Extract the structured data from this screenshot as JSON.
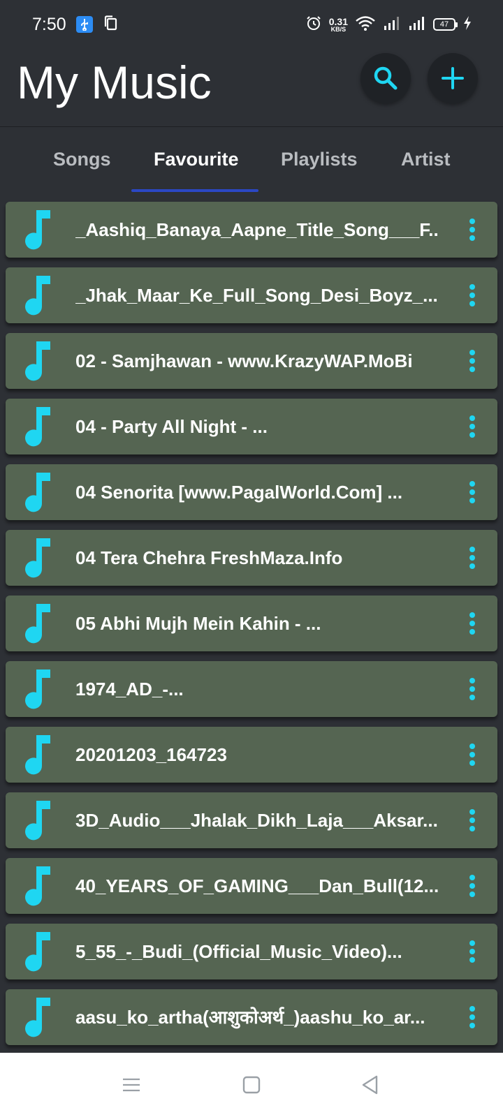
{
  "status_bar": {
    "time": "7:50",
    "net_speed_value": "0.31",
    "net_speed_unit": "KB/S",
    "battery": "47",
    "icons": [
      "usb-icon",
      "copy-icon",
      "alarm-icon",
      "wifi-icon",
      "signal-icon",
      "signal-icon",
      "battery-icon",
      "charging-icon"
    ]
  },
  "header": {
    "title": "My Music",
    "search_icon": "search-icon",
    "add_icon": "plus-icon"
  },
  "tabs": [
    {
      "label": "Songs",
      "active": false
    },
    {
      "label": "Favourite",
      "active": true
    },
    {
      "label": "Playlists",
      "active": false
    },
    {
      "label": "Artist",
      "active": false
    }
  ],
  "songs": [
    "_Aashiq_Banaya_Aapne_Title_Song___F...",
    "_Jhak_Maar_Ke_Full_Song_Desi_Boyz_...",
    "02 - Samjhawan - www.KrazyWAP.MoBi",
    "04 - Party All Night - ...",
    "04 Senorita [www.PagalWorld.Com] ...",
    "04 Tera Chehra FreshMaza.Info",
    "05 Abhi Mujh Mein Kahin  - ...",
    "1974_AD_-...",
    "20201203_164723",
    "3D_Audio___Jhalak_Dikh_Laja___Aksar...",
    "40_YEARS_OF_GAMING___Dan_Bull(12...",
    "5_55_-_Budi_(Official_Music_Video)...",
    "aasu_ko_artha(आशुकोअर्थ_)aashu_ko_ar..."
  ],
  "colors": {
    "background": "#2d3035",
    "card": "#556552",
    "accent": "#1fd6f2",
    "tab_indicator": "#2b47c4"
  },
  "nav_bar": {
    "icons": [
      "menu-icon",
      "home-square-icon",
      "back-triangle-icon"
    ]
  }
}
